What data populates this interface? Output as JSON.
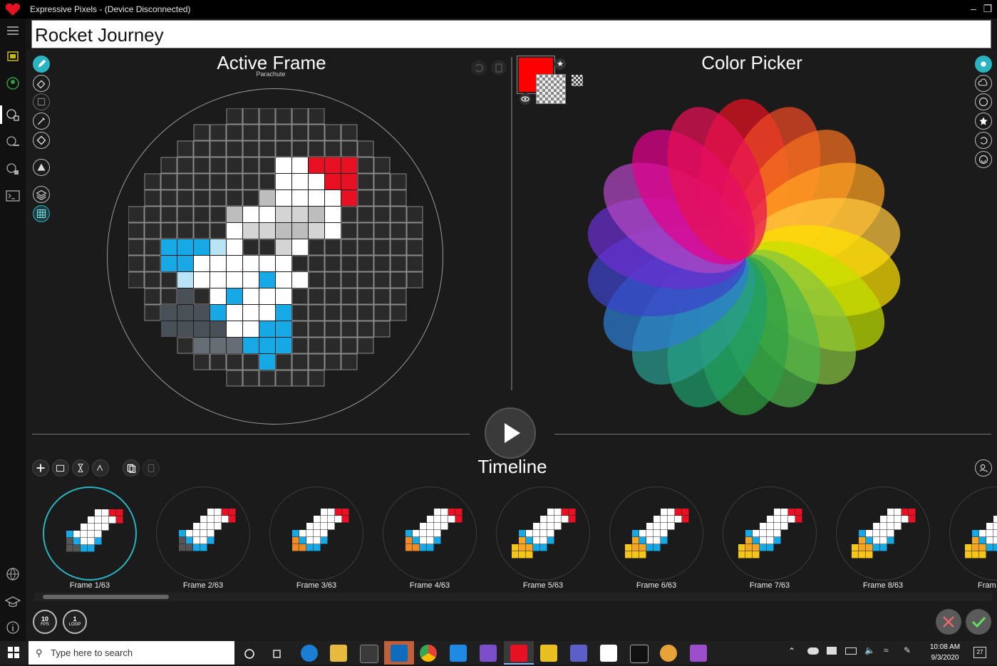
{
  "window": {
    "title": "Expressive Pixels - (Device Disconnected)",
    "controls": [
      "minimize-icon",
      "restore-icon"
    ]
  },
  "project": {
    "name": "Rocket Journey"
  },
  "left_rail": {
    "items": [
      "hamburger-menu-icon",
      "device-icon",
      "profile-icon",
      "animations-icon",
      "gallery-icon",
      "tools-icon",
      "terminal-icon",
      "globe-icon",
      "learn-icon",
      "info-icon"
    ]
  },
  "active_frame": {
    "title": "Active Frame",
    "subtitle": "Parachute",
    "tools": [
      "pencil-icon",
      "eraser-icon",
      "select-icon",
      "eyedropper-icon",
      "fill-icon",
      "shape-icon",
      "layers-icon",
      "grid-icon"
    ],
    "header_actions": [
      "undo-icon",
      "clipboard-icon"
    ]
  },
  "color_picker": {
    "title": "Color Picker",
    "primary_color": "#ff0000",
    "modes": [
      "wheel-icon",
      "cloud-palette-icon",
      "palette-icon",
      "star-icon",
      "recent-icon",
      "emoji-icon"
    ],
    "wheel_colors": [
      "#e81123",
      "#f04a24",
      "#f7711f",
      "#ffa323",
      "#ffc83d",
      "#fce100",
      "#c0e000",
      "#86c440",
      "#4cb54a",
      "#2ea043",
      "#1f9e6a",
      "#2a9d8f",
      "#2d7dd2",
      "#3b43c9",
      "#6a2fd0",
      "#b146c2",
      "#e3008c",
      "#e81154"
    ]
  },
  "timeline": {
    "title": "Timeline",
    "actions": [
      "add-frame-icon",
      "add-image-icon",
      "add-delay-icon",
      "add-transition-icon",
      "copy-frame-icon",
      "paste-frame-icon"
    ],
    "frames": [
      {
        "label": "Frame 1/63",
        "selected": true
      },
      {
        "label": "Frame 2/63",
        "selected": false
      },
      {
        "label": "Frame 3/63",
        "selected": false
      },
      {
        "label": "Frame 4/63",
        "selected": false
      },
      {
        "label": "Frame 5/63",
        "selected": false
      },
      {
        "label": "Frame 6/63",
        "selected": false
      },
      {
        "label": "Frame 7/63",
        "selected": false
      },
      {
        "label": "Frame 8/63",
        "selected": false
      },
      {
        "label": "Fram",
        "selected": false
      }
    ],
    "fps": "10",
    "fps_unit": "FPS",
    "loop": "1",
    "loop_unit": "LOOP"
  },
  "taskbar": {
    "search_placeholder": "Type here to search",
    "time": "10:08 AM",
    "date": "9/3/2020",
    "notifications": "27"
  }
}
